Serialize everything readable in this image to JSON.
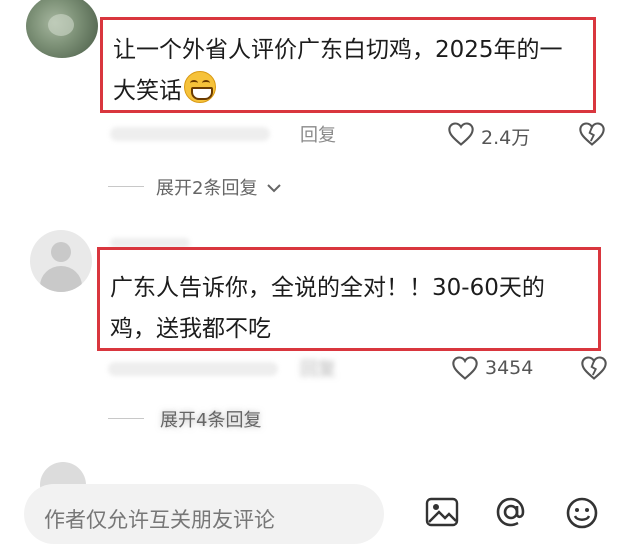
{
  "comments": [
    {
      "text": "让一个外省人评价广东白切鸡，2025年的一大笑话",
      "emoji": "grinning-squint-emoji",
      "reply_label": "回复",
      "like_count": "2.4万",
      "expand_label": "展开2条回复"
    },
    {
      "text": "广东人告诉你，全说的全对！！30-60天的鸡，送我都不吃",
      "reply_label": "回复",
      "like_count": "3454",
      "expand_label": "展开4条回复"
    }
  ],
  "reply_bar": {
    "placeholder": "作者仅允许互关朋友评论",
    "icons": [
      "image-icon",
      "mention-icon",
      "emoji-icon"
    ]
  },
  "colors": {
    "highlight_border": "#d9363e",
    "meta_text": "#8a8a8a"
  }
}
